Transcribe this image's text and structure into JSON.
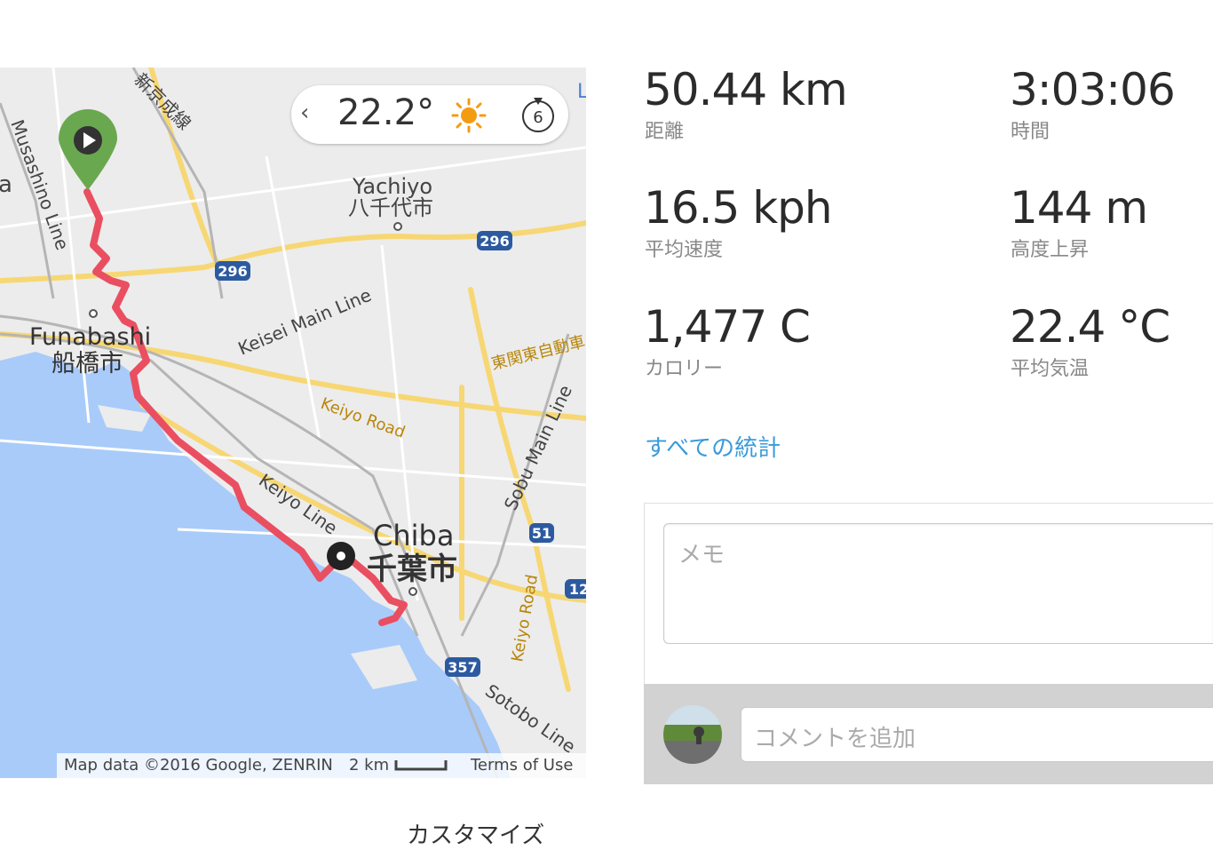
{
  "map": {
    "labels": {
      "shinkeisei_line": "新京成線",
      "musashino_line": "Musashino Line",
      "a_partial": "a",
      "yachiyo_en": "Yachiyo",
      "yachiyo_jp": "八千代市",
      "route_296_a": "296",
      "route_296_b": "296",
      "keisei_main_line": "Keisei Main Line",
      "funabashi_en": "Funabashi",
      "funabashi_jp": "船橋市",
      "higashikanto": "東関東自動車",
      "keiyo_road": "Keiyo Road",
      "keiyo_line": "Keiyo Line",
      "sobu_main_line": "Sobu Main Line",
      "chiba_en": "Chiba",
      "chiba_jp": "千葉市",
      "route_51": "51",
      "route_12": "12",
      "keiyo_road_v": "Keiyo Road",
      "route_357": "357",
      "sotobo_line": "Sotobo Line",
      "l_partial": "L"
    },
    "weather": {
      "temperature": "22.2°",
      "wind": "6"
    },
    "attribution": {
      "map_data": "Map data ©2016 Google, ZENRIN",
      "scale": "2 km",
      "terms": "Terms of Use"
    },
    "colors": {
      "water": "#a9cbfa",
      "land": "#ececec",
      "route": "#e94f61",
      "start_marker": "#6aa84f"
    }
  },
  "stats": {
    "distance": {
      "value": "50.44 km",
      "label": "距離"
    },
    "time": {
      "value": "3:03:06",
      "label": "時間"
    },
    "avg_speed": {
      "value": "16.5 kph",
      "label": "平均速度"
    },
    "elevation_gain": {
      "value": "144 m",
      "label": "高度上昇"
    },
    "calories": {
      "value": "1,477 C",
      "label": "カロリー"
    },
    "avg_temp": {
      "value": "22.4 °C",
      "label": "平均気温"
    }
  },
  "all_stats_link": "すべての統計",
  "memo": {
    "placeholder": "メモ"
  },
  "comment": {
    "placeholder": "コメントを追加"
  },
  "customize": "カスタマイズ"
}
